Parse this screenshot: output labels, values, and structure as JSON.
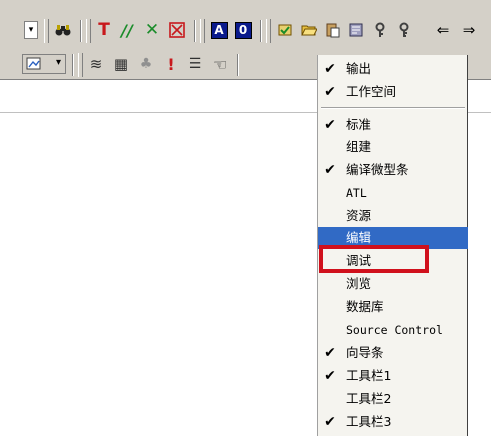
{
  "toolbar": {
    "row1_icons": [
      "binoculars-icon",
      "text-T-icon",
      "double-slash-icon",
      "x-mark-icon",
      "x-box-icon",
      "A",
      "0",
      "workspace-icon",
      "open-folder-icon",
      "paste-icon",
      "compile-icon",
      "key-icon",
      "key2-icon",
      "arrow-left-icon",
      "arrow-right-icon"
    ],
    "text_tool_glyph": "T",
    "comment_glyph": "//",
    "cross_glyph": "✕",
    "box_a_label": "A",
    "box_0_label": "0",
    "arrow_left_glyph": "⇐",
    "arrow_right_glyph": "⇒",
    "row2_glyphs": {
      "stack": "≋",
      "grid": "▦",
      "build": "♣",
      "execute": "!",
      "list": "☰",
      "hand": "☜"
    },
    "combo_arrow": "▾",
    "accent_red": "#c8181c",
    "accent_green": "#1a8c2a",
    "accent_blue": "#0a1a8c"
  },
  "menu": {
    "check_glyph": "✔",
    "highlight_color": "#316ac5",
    "callout_color": "#d0101c",
    "items": [
      {
        "label": "输出",
        "checked": true
      },
      {
        "label": "工作空间",
        "checked": true
      },
      {
        "label": "标准",
        "checked": true
      },
      {
        "label": "组建",
        "checked": false
      },
      {
        "label": "编译微型条",
        "checked": true
      },
      {
        "label": "ATL",
        "checked": false
      },
      {
        "label": "资源",
        "checked": false
      },
      {
        "label": "编辑",
        "checked": false,
        "highlighted": true
      },
      {
        "label": "调试",
        "checked": false
      },
      {
        "label": "浏览",
        "checked": false
      },
      {
        "label": "数据库",
        "checked": false
      },
      {
        "label": "Source Control",
        "checked": false
      },
      {
        "label": "向导条",
        "checked": true
      },
      {
        "label": "工具栏1",
        "checked": true
      },
      {
        "label": "工具栏2",
        "checked": false
      },
      {
        "label": "工具栏3",
        "checked": true
      }
    ]
  }
}
